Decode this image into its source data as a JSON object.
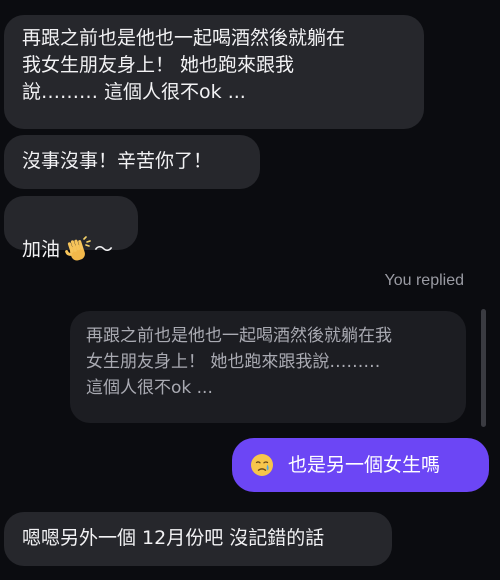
{
  "messages": {
    "incoming_1": "再跟之前也是他也一起喝酒然後就躺在\n我女生朋友身上！ 她也跑來跟我\n說……… 這個人很不ok ...",
    "incoming_2": "沒事沒事！辛苦你了！",
    "incoming_3_text": "加油",
    "incoming_3_suffix": "～",
    "incoming_3_icon": "clapping-hands-icon",
    "replied_label": "You replied",
    "quoted_message": "再跟之前也是他也一起喝酒然後就躺在我\n女生朋友身上！ 她也跑來跟我說………\n這個人很不ok ...",
    "outgoing_icon": "crying-face-icon",
    "outgoing_text": "也是另一個女生嗎",
    "incoming_4": "嗯嗯另外一個 12月份吧 沒記錯的話"
  },
  "colors": {
    "background": "#0b0c10",
    "incoming_bubble": "#26272c",
    "quoted_bubble": "#1c1d22",
    "outgoing_bubble": "#6c46f5"
  }
}
